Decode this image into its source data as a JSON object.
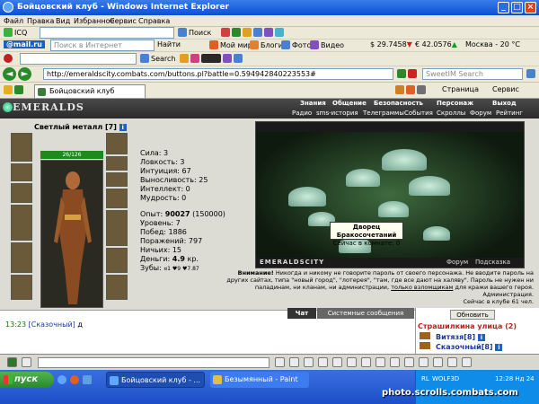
{
  "window": {
    "title": "Бойцовский клуб - Windows Internet Explorer"
  },
  "menu": [
    "Файл",
    "Правка",
    "Вид",
    "Избранное",
    "Сервис",
    "Справка"
  ],
  "toolbar1": {
    "icq": "ICQ",
    "search": "Поиск"
  },
  "toolbar2": {
    "mailru": "@mail.ru",
    "search_placeholder": "Поиск в Интернет",
    "find": "Найти",
    "my_world": "Мой мир",
    "blogs": "Блоги",
    "photo": "Фото",
    "video": "Видео",
    "usd": "$ 29.7458",
    "eur": "€ 42.0576",
    "weather": "Москва - 20 °C"
  },
  "toolbar3": {
    "search": "Search"
  },
  "address": {
    "url": "http://emeraldscity.combats.com/buttons.pl?battle=0.594942840223553#",
    "search_placeholder": "SweetIM Search"
  },
  "tabs": {
    "active": "Бойцовский клуб",
    "page_menu": "Страница",
    "tools_menu": "Сервис"
  },
  "game": {
    "logo": "EMERALDS",
    "topnav": [
      "Знания",
      "Общение",
      "Безопасность",
      "Персонаж",
      "Выход"
    ],
    "subnav": [
      "Радио",
      "sms-история",
      "Телеграммы",
      "События",
      "Скроллы",
      "Форум",
      "Рейтинг"
    ],
    "character": {
      "name": "Светлый металл",
      "level_tag": "[7]",
      "hp": "26/126",
      "stats": [
        "Сила: 3",
        "Ловкость: 3",
        "Интуиция: 67",
        "Выносливость: 25",
        "Интеллект: 0",
        "Мудрость: 0"
      ],
      "exp_label": "Опыт:",
      "exp_value": "90027",
      "exp_next": "(150000)",
      "info": [
        "Уровень: 7",
        "Побед: 1886",
        "Поражений: 797",
        "Ничьих: 15"
      ],
      "money_label": "Деньги:",
      "money_value": "4.9",
      "money_unit": "кр.",
      "teeth": "Зубы:",
      "teeth_values": "¤1 ♥9 ♥7.87"
    },
    "scene": {
      "tooltip_title": "Дворец Бракосочетаний",
      "tooltip_sub": "Сейчас в комнате: 0",
      "city": "EMERALDSCITY",
      "forum": "Форум",
      "hint": "Подсказка"
    },
    "notice": {
      "bold": "Внимание!",
      "text": "Никогда и никому не говорите пароль от своего персонажа. Не вводите пароль на других сайтах, типа \"новый город\", \"лотерея\", \"там, где все дают на халяву\". Пароль не нужен ни паладинам, ни кланам, ни администрации,",
      "link": "только взломщикам",
      "text_end": "для кражи вашего героя.",
      "admin": "Администрация.",
      "online": "Сейчас в клубе 61 чел."
    },
    "chat": {
      "tab_chat": "Чат",
      "tab_system": "Системные сообщения",
      "time": "13:23",
      "sender": "[Сказочный]",
      "message": "д"
    },
    "right_panel": {
      "refresh": "Обновить",
      "location": "Страшилкина улица (2)",
      "players": [
        "Витязя[8]",
        "Сказочный[8]"
      ]
    }
  },
  "taskbar": {
    "start": "пуск",
    "tasks": [
      "Бойцовский клуб - ...",
      "Безымянный - Paint"
    ],
    "lang": "RL",
    "user": "WOLF3D",
    "clock": "12:28 Нд 24"
  },
  "watermark": "photo.scrolls.combats.com",
  "colors": {
    "title": "#0b4fd6",
    "taskbar": "#1c4fc8",
    "start": "#2a8a2a",
    "hp": "#1c8a1c"
  }
}
